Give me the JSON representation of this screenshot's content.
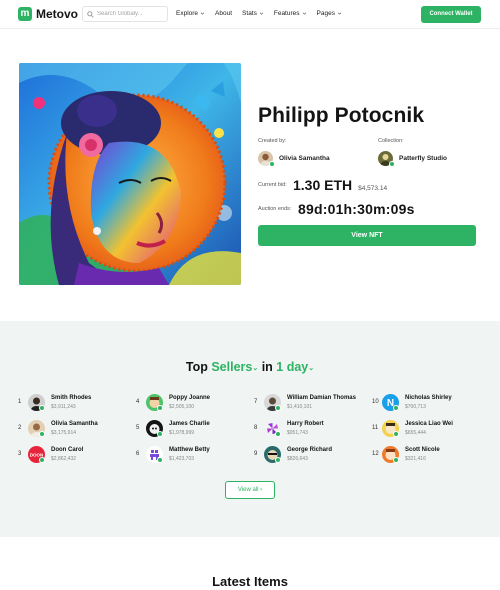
{
  "header": {
    "brand_mark": "m",
    "brand_name": "Metovo",
    "search_placeholder": "Search Globaly...",
    "nav": [
      {
        "label": "Explore",
        "has_dropdown": true
      },
      {
        "label": "About",
        "has_dropdown": false
      },
      {
        "label": "Stats",
        "has_dropdown": true
      },
      {
        "label": "Features",
        "has_dropdown": true
      },
      {
        "label": "Pages",
        "has_dropdown": true
      }
    ],
    "connect_label": "Connect Wallet"
  },
  "hero": {
    "title": "Philipp Potocnik",
    "created_by_label": "Created by:",
    "creator_name": "Olivia Samantha",
    "collection_label": "Collection:",
    "collection_name": "Patterfly Studio",
    "current_bid_label": "Current bid:",
    "current_bid_eth": "1.30 ETH",
    "current_bid_usd": "$4,573.14",
    "auction_label": "Auction ends:",
    "countdown": "89d:01h:30m:09s",
    "view_label": "View NFT"
  },
  "sellers": {
    "title_prefix": "Top",
    "title_highlight": "Sellers",
    "title_middle": "in",
    "title_period": "1 day",
    "items": [
      {
        "rank": "1",
        "name": "Smith Rhodes",
        "amount": "$3,911,243",
        "avatar": "person-dark"
      },
      {
        "rank": "2",
        "name": "Olivia Samantha",
        "amount": "$3,175,914",
        "avatar": "person-light"
      },
      {
        "rank": "3",
        "name": "Doon Carol",
        "amount": "$2,862,432",
        "avatar": "doon-logo"
      },
      {
        "rank": "4",
        "name": "Poppy Joanne",
        "amount": "$2,505,100",
        "avatar": "cartoon-green"
      },
      {
        "rank": "5",
        "name": "James Charlie",
        "amount": "$1,978,999",
        "avatar": "cartoon-dark"
      },
      {
        "rank": "6",
        "name": "Matthew Betty",
        "amount": "$1,423,703",
        "avatar": "pixel-purple"
      },
      {
        "rank": "7",
        "name": "William Damian Thomas",
        "amount": "$1,410,101",
        "avatar": "person-grey"
      },
      {
        "rank": "8",
        "name": "Harry Robert",
        "amount": "$951,743",
        "avatar": "pinwheel-purple"
      },
      {
        "rank": "9",
        "name": "George Richard",
        "amount": "$826,643",
        "avatar": "cartoon-teal"
      },
      {
        "rank": "10",
        "name": "Nicholas Shirley",
        "amount": "$700,713",
        "avatar": "n-logo-blue"
      },
      {
        "rank": "11",
        "name": "Jessica Liao Wei",
        "amount": "$655,444",
        "avatar": "cartoon-yellow"
      },
      {
        "rank": "12",
        "name": "Scott Nicole",
        "amount": "$321,416",
        "avatar": "cartoon-orange"
      }
    ],
    "view_all_label": "View all"
  },
  "latest": {
    "title": "Latest Items"
  },
  "colors": {
    "accent": "#2db363",
    "section_bg": "#f0f4f3",
    "text": "#141414"
  }
}
